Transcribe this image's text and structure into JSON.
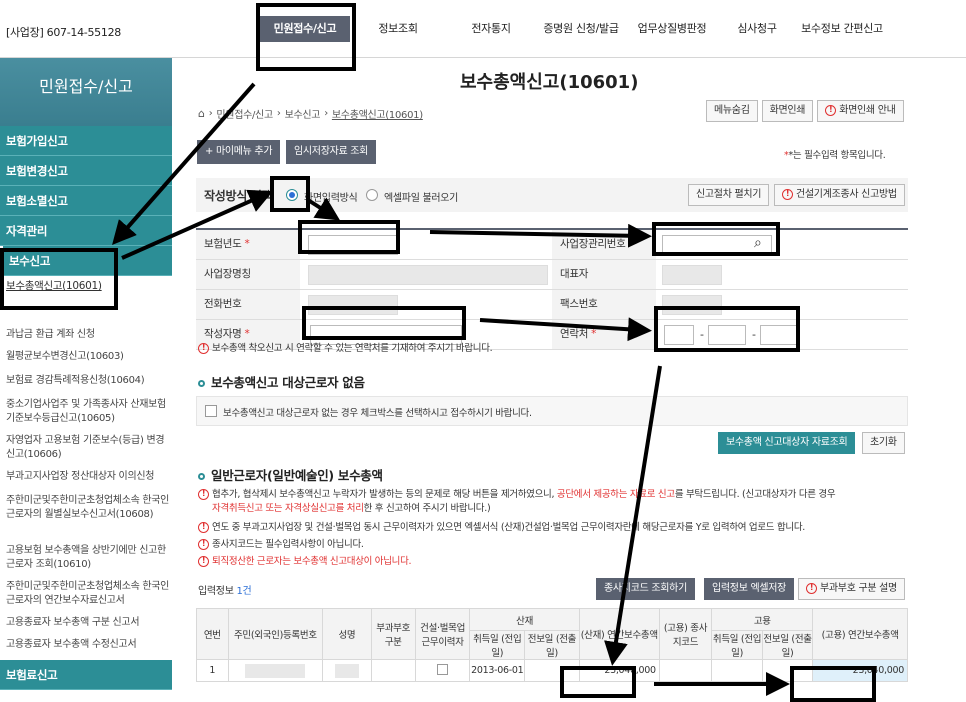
{
  "header": {
    "business": "[사업장] 607-14-55128",
    "nav": [
      "민원접수/신고",
      "정보조회",
      "전자통지",
      "증명원 신청/발급",
      "업무상질병판정",
      "심사청구",
      "보수정보 간편신고"
    ]
  },
  "sidebar": {
    "title": "민원접수/신고",
    "main_items": [
      "보험가입신고",
      "보험변경신고",
      "보험소멸신고",
      "자격관리",
      "보수신고"
    ],
    "sub_item": "보수총액신고(10601)",
    "plain_items": [
      "과납금 환급 계좌 신청",
      "월평균보수변경신고(10603)",
      "보험료 경감특례적용신청(10604)",
      "중소기업사업주 및 가족종사자 산재보험 기준보수등급신고(10605)",
      "자영업자 고용보험 기준보수(등급) 변경신고(10606)",
      "부과고지사업장 정산대상자 이의신청",
      "주한미군및주한미군초청업체소속 한국인근로자의 월별실보수신고서(10608)",
      "고용보험 보수총액을 상반기에만 신고한 근로자 조회(10610)",
      "주한미군및주한미군초청업체소속 한국인근로자의 연간보수자료신고서",
      "고용종료자 보수총액 구분 신고서",
      "고용종료자 보수총액 수정신고서"
    ],
    "bottom_item": "보험료신고"
  },
  "page": {
    "title": "보수총액신고(10601)",
    "breadcrumb": [
      "민원접수/신고",
      "보수신고",
      "보수총액신고(10601)"
    ],
    "top_buttons": [
      "메뉴숨김",
      "화면인쇄",
      "화면인쇄 안내"
    ],
    "add_menu": "+ 마이메뉴 추가",
    "temp_save": "임시저장자료 조회",
    "required_note": "*는 필수입력 항목입니다.",
    "method_label": "작성방식 선택",
    "method_options": [
      "화면입력방식",
      "엑셀파일 불러오기"
    ],
    "procedure_btn": "신고절차 펼치기",
    "construction_btn": "건설기계조종사 신고방법"
  },
  "form": {
    "year_label": "보험년도",
    "bizno_label": "사업장관리번호",
    "bizname_label": "사업장명칭",
    "ceo_label": "대표자",
    "phone_label": "전화번호",
    "fax_label": "팩스번호",
    "writer_label": "작성자명",
    "contact_label": "연락처",
    "note": "보수총액 착오신고 시 연락할 수 있는 연락처를 기재하여 주시기 바랍니다."
  },
  "no_target": {
    "title": "보수총액신고 대상근로자 없음",
    "checkbox_text": "보수총액신고 대상근로자 없는 경우 체크박스를 선택하시고 접수하시기 바랍니다.",
    "lookup_btn": "보수총액 신고대상자 자료조회",
    "reset_btn": "초기화"
  },
  "general": {
    "title": "일반근로자(일반예술인) 보수총액",
    "notice1a": "협추가, 협삭제시 보수총액신고 누락자가 발생하는 등의 문제로 해당 버튼을 제거하였으니, ",
    "notice1b": "공단에서 제공하는 자료로 신고",
    "notice1c": "를 부탁드립니다. (신고대상자가 다른 경우",
    "notice1d": "자격취득신고 또는 자격상실신고를 처리",
    "notice1e": "한 후 신고하여 주시기 바랍니다.)",
    "notice2": "연도 중 부과고지사업장 및 건설·벌목업 동시 근무이력자가 있으면 엑셀서식 (산재)건설업·벌목업 근무이력자란에 해당근로자를 Y로 입력하여 업로드 합니다.",
    "notice3": "종사지코드는 필수입력사항이 아닙니다.",
    "notice4": "퇴직정산한 근로자는 보수총액 신고대상이 아닙니다.",
    "input_info_label": "입력정보",
    "input_info_count": "1건",
    "btn_code": "종사지코드 조회하기",
    "btn_excel": "입력정보 엑셀저장",
    "btn_split": "부과부호 구분 설명"
  },
  "table": {
    "headers": {
      "no": "연번",
      "rrn": "주민(외국인)등록번호",
      "name": "성명",
      "code": "부과부호 구분",
      "construction": "건설·벌목업 근무이력자",
      "sanjae": "산재",
      "acquire": "취득일 (전입일)",
      "transfer": "전보일 (전출일)",
      "sanjae_total": "(산재) 연간보수총액",
      "goyong_code": "(고용) 종사지코드",
      "goyong": "고용",
      "goyong_acquire": "취득일 (전입일)",
      "goyong_transfer": "전보일 (전출일)",
      "goyong_total": "(고용) 연간보수총액"
    },
    "rows": [
      {
        "no": "1",
        "acquire": "2013-06-01",
        "sanjae_total": "23,040,000",
        "goyong_total": "23,040,000"
      }
    ]
  }
}
